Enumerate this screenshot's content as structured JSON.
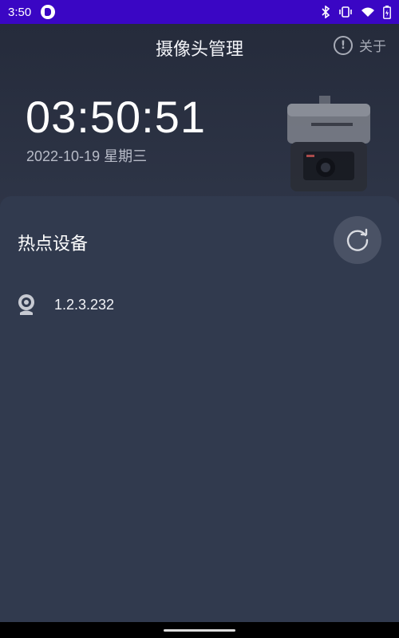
{
  "status_bar": {
    "time": "3:50",
    "icons": [
      "app-notification-icon",
      "bluetooth-icon",
      "vibrate-icon",
      "wifi-icon",
      "battery-icon"
    ],
    "background": "#3a06c4"
  },
  "header": {
    "title": "摄像头管理",
    "about_label": "关于",
    "about_icon": "info-circle-icon"
  },
  "clock": {
    "time": "03:50:51",
    "date": "2022-10-19 星期三"
  },
  "hotspot": {
    "section_title": "热点设备",
    "refresh_icon": "refresh-icon",
    "devices": [
      {
        "icon": "webcam-icon",
        "ip": "1.2.3.232"
      }
    ]
  },
  "colors": {
    "background": "#2f3648",
    "card": "#313a4e",
    "refresh_button": "#4a5265"
  }
}
